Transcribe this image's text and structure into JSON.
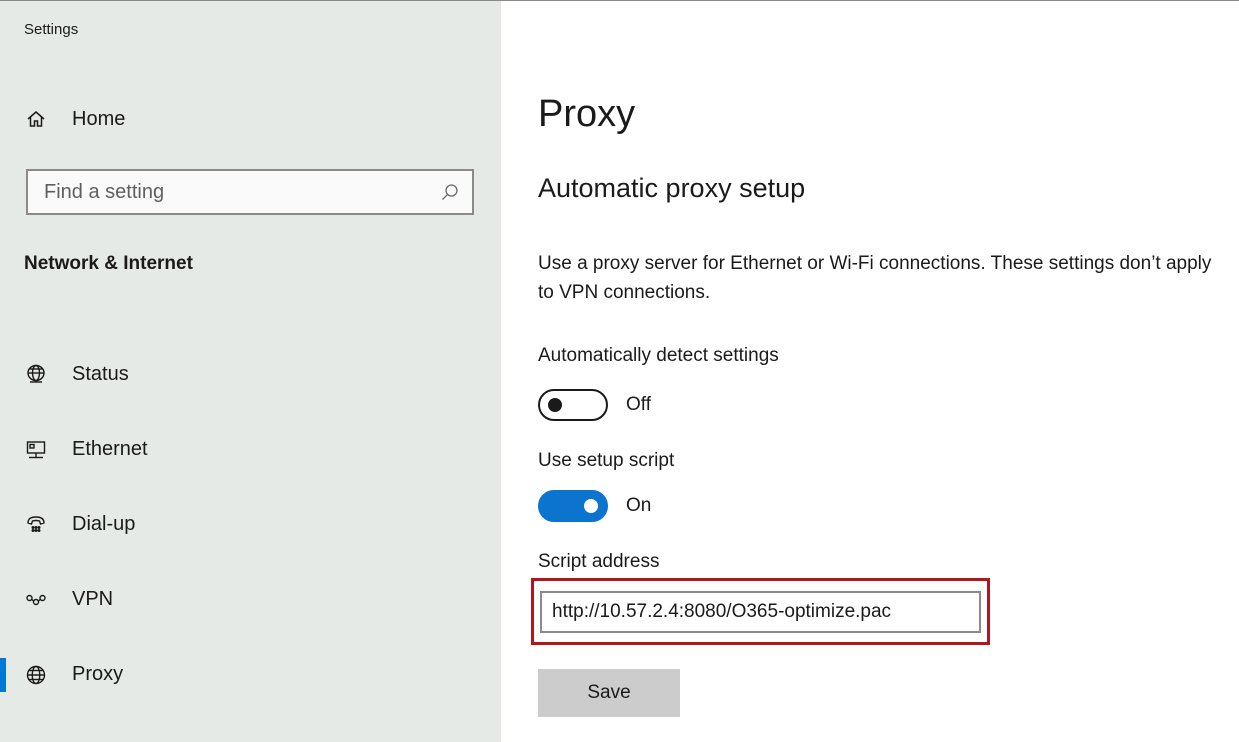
{
  "app": {
    "title": "Settings"
  },
  "sidebar": {
    "home": {
      "label": "Home",
      "icon": "home-icon"
    },
    "search": {
      "placeholder": "Find a setting",
      "value": "",
      "icon": "search-icon"
    },
    "section_header": "Network & Internet",
    "items": [
      {
        "label": "Status",
        "icon": "globe-status-icon",
        "selected": false
      },
      {
        "label": "Ethernet",
        "icon": "ethernet-icon",
        "selected": false
      },
      {
        "label": "Dial-up",
        "icon": "dial-up-icon",
        "selected": false
      },
      {
        "label": "VPN",
        "icon": "vpn-icon",
        "selected": false
      },
      {
        "label": "Proxy",
        "icon": "globe-icon",
        "selected": true
      }
    ],
    "accent_color": "#0078d4"
  },
  "main": {
    "title": "Proxy",
    "section_title": "Automatic proxy setup",
    "description": "Use a proxy server for Ethernet or Wi-Fi connections. These settings don’t apply to VPN connections.",
    "auto_detect": {
      "label": "Automatically detect settings",
      "state": "Off",
      "enabled": false
    },
    "setup_script": {
      "label": "Use setup script",
      "state": "On",
      "enabled": true
    },
    "script_address": {
      "label": "Script address",
      "value": "http://10.57.2.4:8080/O365-optimize.pac"
    },
    "save_label": "Save",
    "highlight_color": "#b0161c",
    "toggle_on_color": "#0a74cf"
  }
}
